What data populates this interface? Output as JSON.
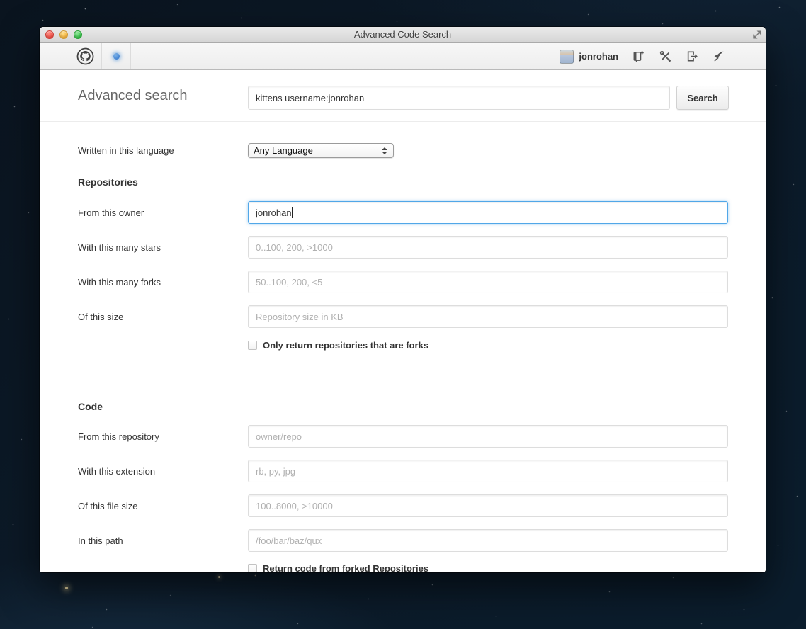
{
  "window": {
    "title": "Advanced Code Search"
  },
  "github_header": {
    "logo": "github-octocat-logo",
    "notification_dot_color": "#4a90d9",
    "user": {
      "name": "jonrohan"
    },
    "icons": [
      {
        "name": "create-repo-icon"
      },
      {
        "name": "tools-icon"
      },
      {
        "name": "sign-out-icon"
      },
      {
        "name": "rocket-icon"
      }
    ]
  },
  "search_header": {
    "heading": "Advanced search",
    "query": "kittens username:jonrohan",
    "search_button": "Search"
  },
  "form": {
    "language_row": {
      "label": "Written in this language",
      "selected": "Any Language"
    },
    "repositories": {
      "heading": "Repositories",
      "fields": [
        {
          "label": "From this owner",
          "value": "jonrohan"
        },
        {
          "label": "With this many stars",
          "placeholder": "0..100, 200, >1000"
        },
        {
          "label": "With this many forks",
          "placeholder": "50..100, 200, <5"
        },
        {
          "label": "Of this size",
          "placeholder": "Repository size in KB"
        }
      ],
      "checkbox_label": "Only return repositories that are forks",
      "checkbox_checked": false
    },
    "code": {
      "heading": "Code",
      "fields": [
        {
          "label": "From this repository",
          "placeholder": "owner/repo"
        },
        {
          "label": "With this extension",
          "placeholder": "rb, py, jpg"
        },
        {
          "label": "Of this file size",
          "placeholder": "100..8000, >10000"
        },
        {
          "label": "In this path",
          "placeholder": "/foo/bar/baz/qux"
        }
      ],
      "checkbox_label": "Return code from forked Repositories",
      "checkbox_checked": false
    }
  },
  "colors": {
    "focus_border": "#51a7e8",
    "traffic_close": "#f95148",
    "traffic_minimize": "#fcb73e",
    "traffic_zoom": "#35c649"
  }
}
